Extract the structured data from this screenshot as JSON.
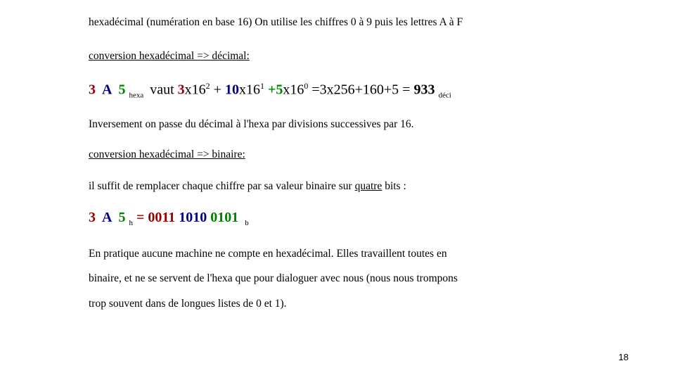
{
  "slide": {
    "intro": {
      "text": "hexadécimal (numération en base 16)  On utilise les chiffres 0 à 9 puis les lettres A à F"
    },
    "heading_decimal": "conversion hexadécimal => décimal:",
    "equation_decimal": {
      "digit_3": "3",
      "digit_A": "A",
      "digit_5": "5",
      "base_sub": "hexa",
      "verb": "vaut",
      "term1_coef": "3",
      "term1_rest": "x16",
      "term1_exp": "2",
      "plus1": "+",
      "term2_coef": "10",
      "term2_rest": "x16",
      "term2_exp": "1",
      "plus2": "+",
      "term3_coef": "5",
      "term3_rest": "x16",
      "term3_exp": "0",
      "expansion": "=3x256+160+5 =",
      "result": "933",
      "result_sub": "déci"
    },
    "note_inverse": "Inversement on passe du décimal à l'hexa par divisions successives par 16.",
    "heading_binary": "conversion hexadécimal => binaire:",
    "rule_line": {
      "before": "il suffit de remplacer chaque chiffre par sa valeur binaire sur ",
      "underlined": "quatre",
      "after": " bits :"
    },
    "equation_binary": {
      "digit_3": "3",
      "digit_A": "A",
      "digit_5": "5",
      "base_sub": "h",
      "equals": "=",
      "bin_3": "0011",
      "bin_A": "1010",
      "bin_5": "0101",
      "result_sub": "b"
    },
    "closing": {
      "line1": "En pratique aucune machine ne compte en hexadécimal. Elles travaillent toutes en",
      "line2": "binaire, et ne se servent de l'hexa que pour dialoguer avec nous (nous nous trompons",
      "line3": "trop souvent dans de longues listes de 0 et 1)."
    },
    "page_number": "18",
    "colors": {
      "red": "#990000",
      "blue": "#000080",
      "green": "#008000",
      "text": "#000000",
      "background": "#ffffff"
    }
  }
}
